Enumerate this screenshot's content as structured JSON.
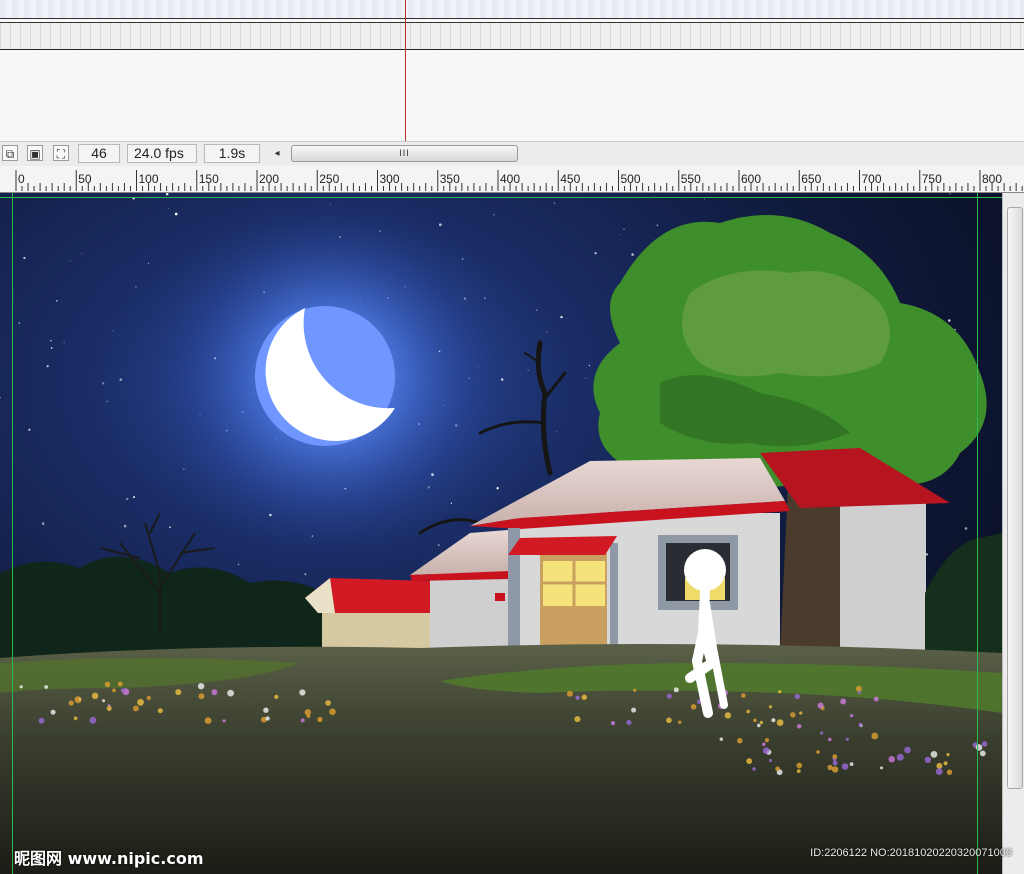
{
  "timeline": {
    "status": {
      "frame": "46",
      "fps": "24.0 fps",
      "time": "1.9s",
      "scroll_grip": "III"
    },
    "icons": [
      "onion-skin-icon",
      "onion-skin-outline-icon",
      "edit-multiple-frames-icon"
    ]
  },
  "ruler": {
    "labels": [
      "0",
      "50",
      "100",
      "150",
      "200",
      "250",
      "300",
      "350",
      "400",
      "450",
      "500",
      "550",
      "600",
      "650",
      "700",
      "750",
      "800"
    ]
  },
  "stage": {
    "scene": "night-house-moon",
    "colors": {
      "sky_top": "#0b0f2a",
      "sky_mid": "#16244f",
      "moon": "#ffffff",
      "moon_glow": "#5b8cff",
      "roof": "#c8131f",
      "wall": "#d7d7d7",
      "window_light": "#f5e27a",
      "tree": "#3f8e2c",
      "ground": "#3a3f2f",
      "guide": "#2fb84a"
    }
  },
  "watermark": {
    "left": "昵图网 www.nipic.com",
    "right": "ID:2206122 NO:20181020220320071000"
  }
}
